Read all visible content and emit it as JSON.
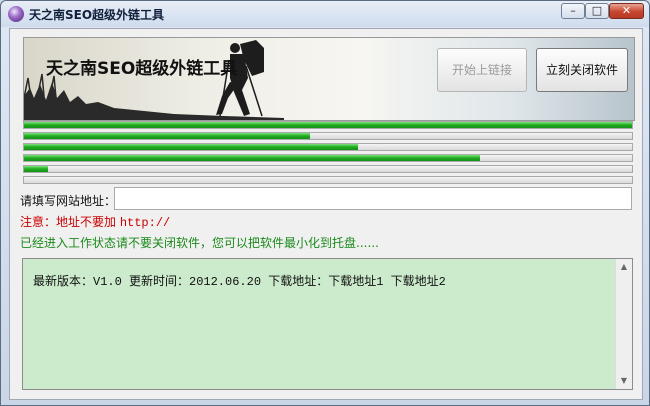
{
  "window": {
    "title": "天之南SEO超级外链工具"
  },
  "caption": {
    "minimize": "–",
    "maximize": "□",
    "close": "✕"
  },
  "banner": {
    "title": "天之南SEO超级外链工具"
  },
  "buttons": {
    "start": "开始上链接",
    "close_app": "立刻关闭软件"
  },
  "progress": [
    {
      "value": 1.0
    },
    {
      "value": 0.47
    },
    {
      "value": 0.55
    },
    {
      "value": 0.75
    },
    {
      "value": 0.04
    },
    {
      "value": 0.0
    }
  ],
  "form": {
    "url_label": "请填写网站地址：",
    "url_value": "",
    "url_placeholder": ""
  },
  "notice": {
    "prefix": "注意：地址不要加 ",
    "code": "http://"
  },
  "status": {
    "text": "已经进入工作状态请不要关闭软件，您可以把软件最小化到托盘......"
  },
  "log": {
    "text": "最新版本：V1.0 更新时间：2012.06.20 下载地址：下载地址1 下载地址2"
  },
  "scroll": {
    "up": "▲",
    "down": "▼"
  }
}
